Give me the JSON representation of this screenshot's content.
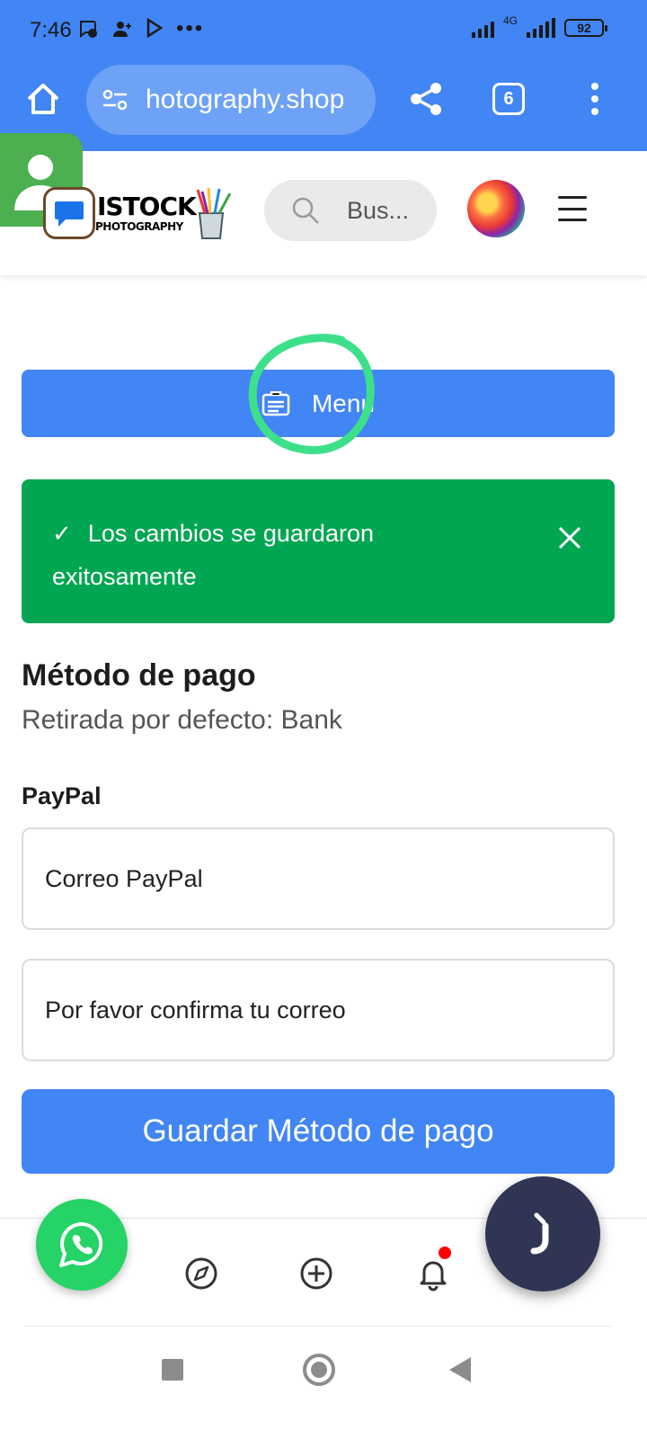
{
  "status_bar": {
    "time": "7:46",
    "network_label": "4G",
    "battery": "92"
  },
  "browser": {
    "url": "hotography.shop",
    "tab_count": "6"
  },
  "site_header": {
    "logo_text": "ISTOCK",
    "logo_subtext": "PHOTOGRAPHY",
    "search_placeholder": "Bus..."
  },
  "menu_button": {
    "label": "Menu"
  },
  "alert": {
    "check_icon": "✓",
    "message": "Los cambios se guardaron exitosamente"
  },
  "payment": {
    "title": "Método de pago",
    "default_withdrawal": "Retirada por defecto: Bank",
    "paypal_label": "PayPal",
    "email_placeholder": "Correo PayPal",
    "confirm_placeholder": "Por favor confirma tu correo",
    "save_label": "Guardar Método de pago"
  },
  "colors": {
    "brand_blue": "#4285f4",
    "success_green": "#00a651",
    "whatsapp_green": "#25d366",
    "chat_fab": "#2f3553",
    "annotation_circle": "#3de08a"
  },
  "icons": {
    "bottom_nav": [
      "compass-icon",
      "plus-circle-icon",
      "bell-icon"
    ],
    "system_nav": [
      "recents-icon",
      "home-icon",
      "back-icon"
    ]
  }
}
